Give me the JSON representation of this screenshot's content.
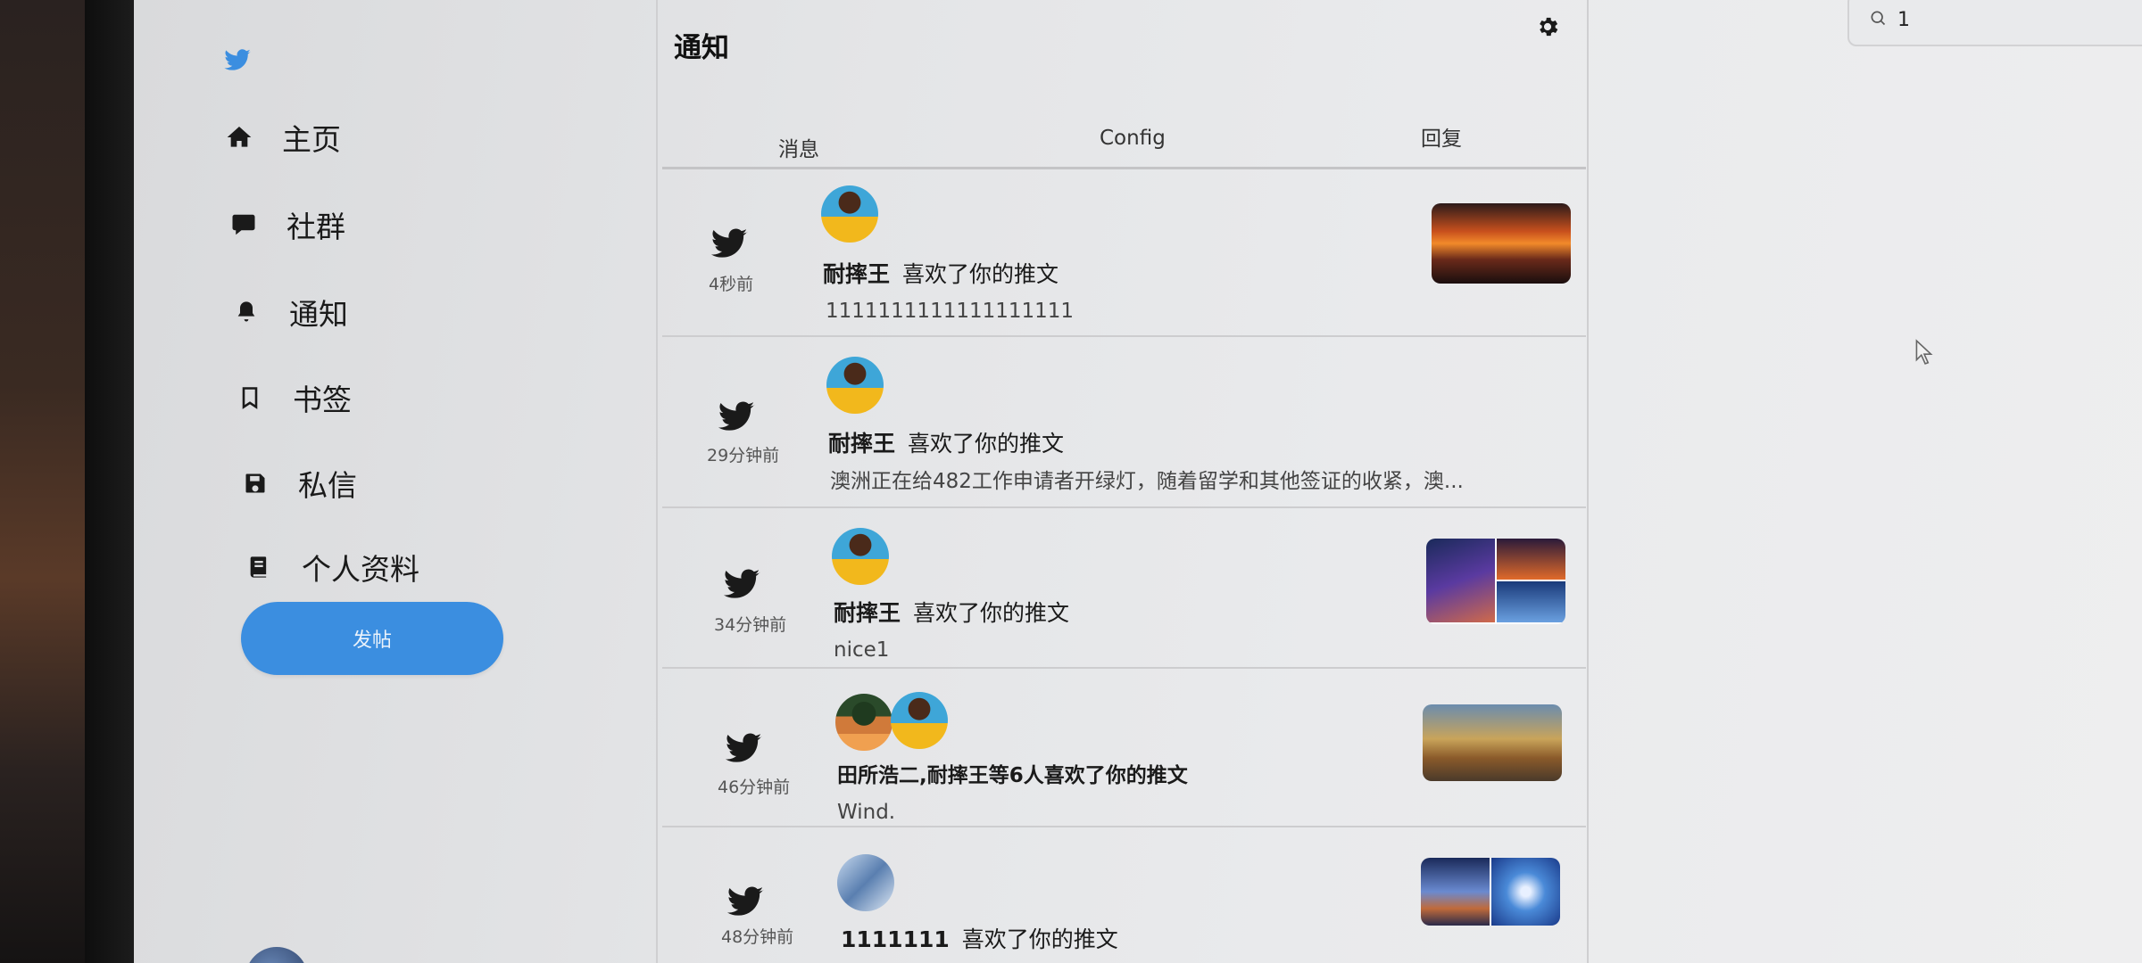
{
  "app": {
    "page_title": "通知",
    "accent_color": "#3b8ee0"
  },
  "sidebar": {
    "items": [
      {
        "label": "主页",
        "icon": "home-icon"
      },
      {
        "label": "社群",
        "icon": "chat-bubble-icon"
      },
      {
        "label": "通知",
        "icon": "bell-icon"
      },
      {
        "label": "书签",
        "icon": "bookmark-icon"
      },
      {
        "label": "私信",
        "icon": "save-icon"
      },
      {
        "label": "个人资料",
        "icon": "book-icon"
      }
    ],
    "post_button": "发帖"
  },
  "tabs": [
    {
      "label": "消息"
    },
    {
      "label": "Config"
    },
    {
      "label": "回复"
    }
  ],
  "notifications": [
    {
      "time": "4秒前",
      "user": "耐摔王",
      "action": "喜欢了你的推文",
      "text": "1111111111111111111"
    },
    {
      "time": "29分钟前",
      "user": "耐摔王",
      "action": "喜欢了你的推文",
      "text": "澳洲正在给482工作申请者开绿灯，随着留学和其他签证的收紧，澳..."
    },
    {
      "time": "34分钟前",
      "user": "耐摔王",
      "action": "喜欢了你的推文",
      "text": "nice1"
    },
    {
      "time": "46分钟前",
      "user": "田所浩二,耐摔王等6人喜欢了你的推文",
      "action": "",
      "text": "Wind."
    },
    {
      "time": "48分钟前",
      "user": "1111111",
      "action": "喜欢了你的推文",
      "text": ""
    }
  ],
  "search": {
    "value": "1"
  }
}
